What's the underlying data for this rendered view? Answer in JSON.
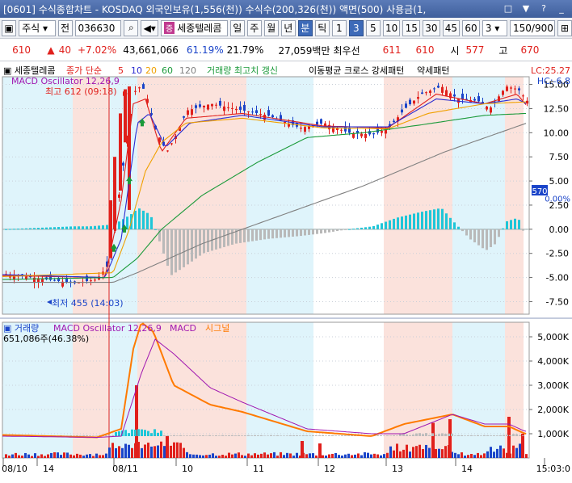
{
  "window": {
    "title": "[0601] 수식종합차트 - KOSDAQ 외국인보유(1,556(천)) 수식수(200,326(천)) 액면(500) 사용금(1,",
    "controls": [
      "□",
      "▼",
      "?",
      "_"
    ]
  },
  "toolbar": {
    "market_select": "주식",
    "prev_label": "전",
    "code": "036630",
    "stock_tag": "증",
    "stock_name": "세종텔레콤",
    "periods": [
      "일",
      "주",
      "월",
      "년",
      "분",
      "틱"
    ],
    "selected_period": "분",
    "intervals": [
      "1",
      "3",
      "5",
      "10",
      "15",
      "30",
      "45",
      "60"
    ],
    "selected_interval": "3",
    "interval_value": "3",
    "count_value": "150",
    "count_total": "/900"
  },
  "quote": {
    "price": "610",
    "change_arrow": "▲",
    "change": "40",
    "change_rate": "+7.02%",
    "volume": "43,661,066",
    "rate1": "61.19%",
    "rate2": "21.79%",
    "amount": "27,059백만",
    "best_label": "최우선",
    "best_ask": "611",
    "best_bid": "610",
    "open_label": "시",
    "open": "577",
    "high_label": "고",
    "high": "670"
  },
  "chart_data": [
    {
      "type": "candlestick",
      "panel": "price",
      "title": "세종텔레콤",
      "legend": [
        "종가 단순",
        "5",
        "10",
        "20",
        "60",
        "120",
        "거래량 최고치 갱신",
        "이동평균 크로스 강세패턴",
        "약세패턴"
      ],
      "overlay_label": "MACD Oscillator 12,26,9",
      "annotations": [
        "최고 612 (09:18)",
        "최저 455 (14:03)"
      ],
      "lc_label": "LC:25.27",
      "hc_label": "HC:-6.8",
      "price_marker": "570",
      "pct_marker": "0.00%",
      "y_ticks": [
        "15.00",
        "12.50",
        "10.00",
        "7.50",
        "5.00",
        "2.50",
        "0.00",
        "-2.50",
        "-5.00",
        "-7.50"
      ],
      "ylim": [
        -8.8,
        15.8
      ]
    },
    {
      "type": "bar",
      "panel": "volume",
      "title": "거래량",
      "legend": [
        "MACD Oscillator 12,26,9",
        "MACD",
        "시그널"
      ],
      "volume_label": "651,086주(46.38%)",
      "y_ticks": [
        "5,000K",
        "4,000K",
        "3,000K",
        "2,000K",
        "1,000K"
      ],
      "ylim": [
        0,
        5600
      ]
    }
  ],
  "x_axis": {
    "labels": [
      "08/10",
      "14",
      "08/11",
      "10",
      "11",
      "12",
      "13",
      "14",
      "15:03:0"
    ]
  }
}
